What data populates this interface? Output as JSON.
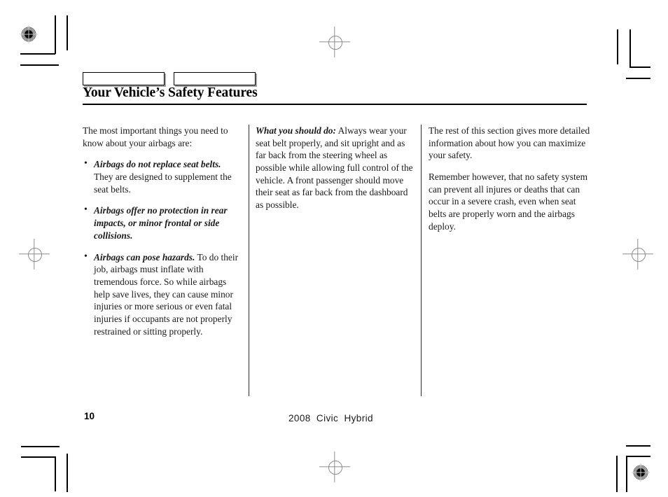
{
  "document": {
    "header": {
      "title": "Your Vehicle’s Safety Features",
      "tabs": [
        {
          "label": ""
        },
        {
          "label": ""
        }
      ]
    },
    "columns": [
      {
        "intro": "The most important things you need to know about your airbags are:",
        "bullets": [
          {
            "lead": "Airbags do not replace seat belts.",
            "body": " They are designed to supplement the seat belts."
          },
          {
            "lead": "Airbags offer no protection in rear impacts, or minor frontal or side collisions.",
            "body": ""
          },
          {
            "lead": "Airbags can pose hazards.",
            "body": " To do their job, airbags must inflate with tremendous force. So while airbags help save lives, they can cause minor injuries or more serious or even fatal injuries if occupants are not properly restrained or sitting properly."
          }
        ]
      },
      {
        "lead": "What you should do:",
        "body": " Always wear your seat belt properly, and sit upright and as far back from the steering wheel as possible while allowing full control of the vehicle. A front passenger should move their seat as far back from the dashboard as possible."
      },
      {
        "paragraphs": [
          "The rest of this section gives more detailed information about how you can maximize your safety.",
          "Remember however, that no safety system can prevent all injures or deaths that can occur in a severe crash, even when seat belts are properly worn and the airbags deploy."
        ]
      }
    ],
    "footer": {
      "page_number": "10",
      "model": "2008  Civic  Hybrid"
    }
  }
}
